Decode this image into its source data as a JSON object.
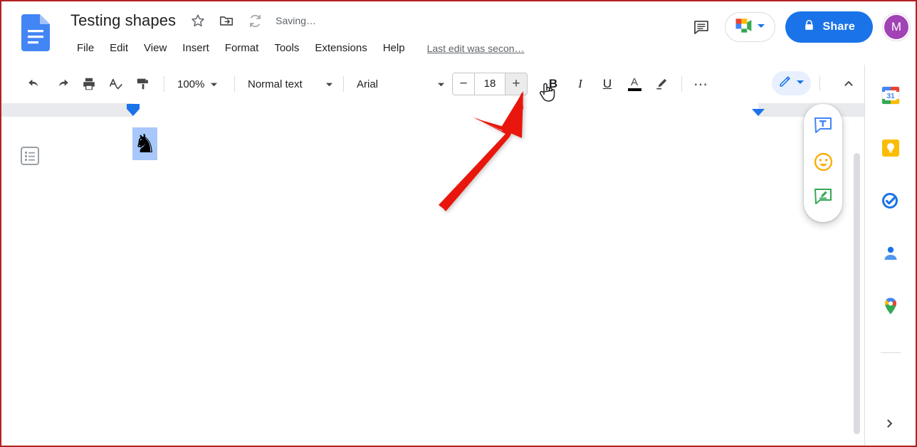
{
  "app": {
    "name": "Google Docs",
    "logo_icon": "docs-logo-icon",
    "accent_blue": "#1a73e8",
    "avatar_color": "#a142b5"
  },
  "header": {
    "doc_title": "Testing shapes",
    "star_icon": "star-outline-icon",
    "move_folder_icon": "move-to-folder-icon",
    "sync_icon": "sync-icon",
    "save_status": "Saving…",
    "last_edit": "Last edit was secon…",
    "menus": [
      {
        "label": "File"
      },
      {
        "label": "Edit"
      },
      {
        "label": "View"
      },
      {
        "label": "Insert"
      },
      {
        "label": "Format"
      },
      {
        "label": "Tools"
      },
      {
        "label": "Extensions"
      },
      {
        "label": "Help"
      }
    ],
    "comment_history_icon": "comment-history-icon",
    "meet_icon": "google-meet-icon",
    "meet_caret_icon": "chevron-down-icon",
    "share_label": "Share",
    "share_lock_icon": "lock-icon",
    "avatar_initial": "M"
  },
  "toolbar": {
    "undo_icon": "undo-icon",
    "redo_icon": "redo-icon",
    "print_icon": "print-icon",
    "spellcheck_icon": "spellcheck-icon",
    "paint_format_icon": "paint-format-icon",
    "zoom_value": "100%",
    "paragraph_style": "Normal text",
    "font_family": "Arial",
    "font_size": "18",
    "decrease_size_label": "−",
    "increase_size_label": "+",
    "bold_label": "B",
    "italic_label": "I",
    "underline_label": "U",
    "text_color_label": "A",
    "highlight_icon": "highlight-pen-icon",
    "more_label": "⋯",
    "mode_icon": "edit-pencil-icon",
    "mode_caret_icon": "chevron-down-icon",
    "collapse_icon": "chevron-up-icon"
  },
  "document": {
    "outline_icon": "document-outline-icon",
    "content_glyph": "♞",
    "glyph_name": "chess-knight-glyph",
    "selection_color": "#a8c7fa"
  },
  "floating_toolbar": {
    "add_comment_icon": "add-comment-icon",
    "emoji_reaction_icon": "emoji-reaction-icon",
    "suggest_edit_icon": "suggest-edit-icon"
  },
  "side_rail": {
    "items": [
      {
        "icon": "google-calendar-icon",
        "label": "Calendar"
      },
      {
        "icon": "google-keep-icon",
        "label": "Keep"
      },
      {
        "icon": "google-tasks-icon",
        "label": "Tasks"
      },
      {
        "icon": "google-contacts-icon",
        "label": "Contacts"
      },
      {
        "icon": "google-maps-icon",
        "label": "Maps"
      }
    ],
    "expand_icon": "chevron-right-icon"
  },
  "annotation": {
    "arrow_color": "#e8150f",
    "arrow_target": "increase-font-size-button",
    "cursor_icon": "hand-pointer-cursor"
  }
}
